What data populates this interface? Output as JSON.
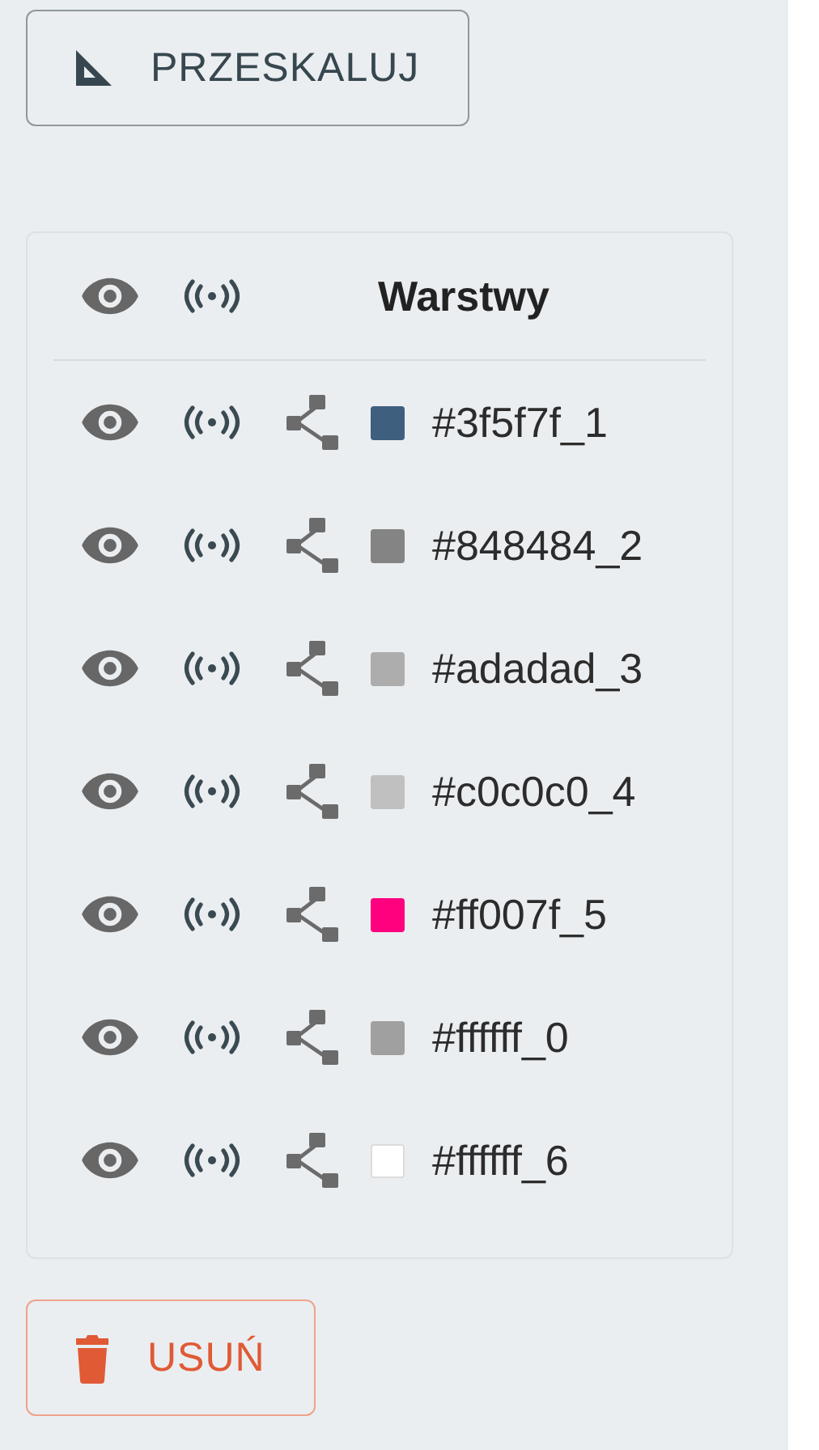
{
  "rescale_button": {
    "label": "PRZESKALUJ"
  },
  "layers_panel": {
    "title": "Warstwy",
    "layers": [
      {
        "name": "#3f5f7f_1",
        "color": "#3f5f7f"
      },
      {
        "name": "#848484_2",
        "color": "#848484"
      },
      {
        "name": "#adadad_3",
        "color": "#adadad"
      },
      {
        "name": "#c0c0c0_4",
        "color": "#c0c0c0"
      },
      {
        "name": "#ff007f_5",
        "color": "#ff007f"
      },
      {
        "name": "#ffffff_0",
        "color": "#a0a0a0"
      },
      {
        "name": "#ffffff_6",
        "color": "#ffffff"
      }
    ]
  },
  "delete_button": {
    "label": "USUŃ"
  }
}
